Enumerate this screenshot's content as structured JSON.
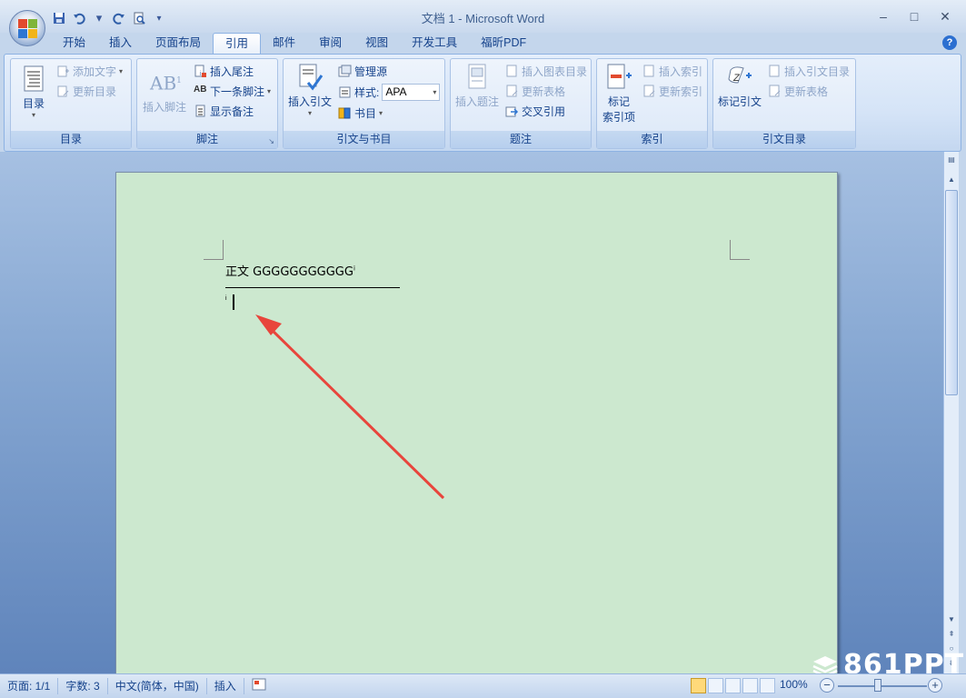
{
  "window": {
    "title": "文档 1 - Microsoft Word",
    "minimize": "–",
    "maximize": "□",
    "close": "✕"
  },
  "qat": {
    "save_icon": "save-icon",
    "undo_icon": "undo-icon",
    "redo_icon": "redo-icon",
    "preview_icon": "print-preview-icon",
    "customize": "▾"
  },
  "tabs": [
    {
      "label": "开始"
    },
    {
      "label": "插入"
    },
    {
      "label": "页面布局"
    },
    {
      "label": "引用",
      "active": true
    },
    {
      "label": "邮件"
    },
    {
      "label": "审阅"
    },
    {
      "label": "视图"
    },
    {
      "label": "开发工具"
    },
    {
      "label": "福昕PDF"
    }
  ],
  "help": "?",
  "ribbon": {
    "toc": {
      "label": "目录",
      "big": "目录",
      "add_text": "添加文字",
      "update_toc": "更新目录"
    },
    "footnotes": {
      "label": "脚注",
      "insert_footnote": "插入脚注",
      "insert_endnote": "插入尾注",
      "next_footnote": "下一条脚注",
      "show_notes": "显示备注"
    },
    "citations": {
      "label": "引文与书目",
      "insert_citation": "插入引文",
      "manage_sources": "管理源",
      "style_label": "样式:",
      "style_value": "APA",
      "bibliography": "书目"
    },
    "captions": {
      "label": "题注",
      "insert_caption": "插入题注",
      "insert_table_of_figures": "插入图表目录",
      "update_table": "更新表格",
      "cross_reference": "交叉引用"
    },
    "index": {
      "label": "索引",
      "mark_entry_1": "标记",
      "mark_entry_2": "索引项",
      "insert_index": "插入索引",
      "update_index": "更新索引"
    },
    "toa": {
      "label": "引文目录",
      "mark_citation": "标记引文",
      "insert_toa": "插入引文目录",
      "update_table": "更新表格"
    }
  },
  "document": {
    "body_text": "正文 GGGGGGGGGGG",
    "footnote_ref": "i",
    "footnote_mark": "i"
  },
  "status": {
    "page": "页面: 1/1",
    "words": "字数: 3",
    "language": "中文(简体，中国)",
    "mode": "插入",
    "zoom": "100%"
  },
  "watermark": "861PPT",
  "annotation_color": "#e8453c"
}
